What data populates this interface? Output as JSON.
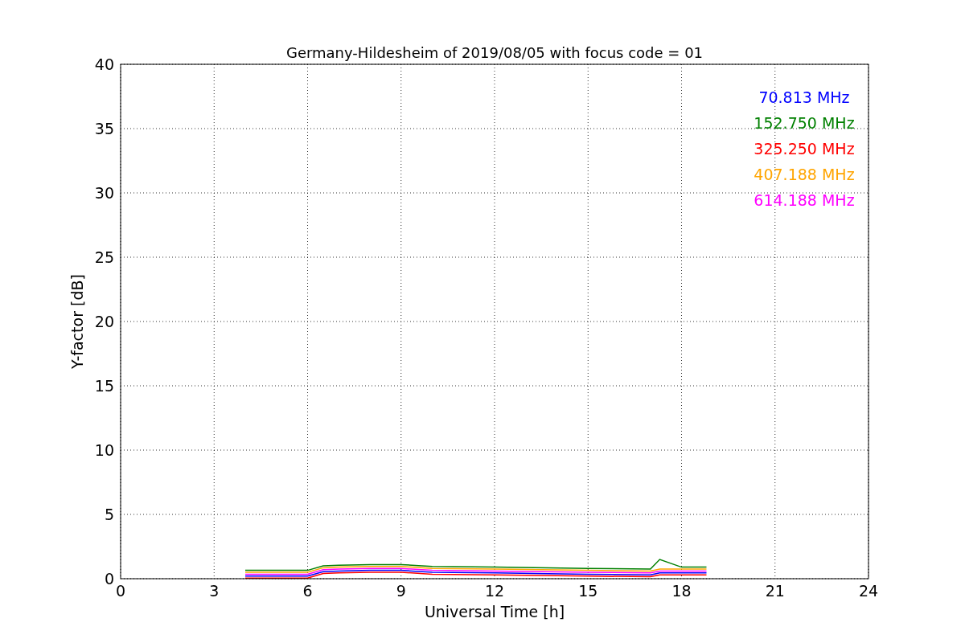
{
  "chart_data": {
    "type": "line",
    "title": "Germany-Hildesheim of 2019/08/05 with focus code = 01",
    "xlabel": "Universal Time [h]",
    "ylabel": "Y-factor [dB]",
    "grid": true,
    "x": [
      4,
      5,
      6,
      6.5,
      7,
      8,
      9,
      10,
      12,
      15,
      17,
      17.3,
      18,
      18.8
    ],
    "series": [
      {
        "name": "70.813 MHz",
        "color": "#0000ff",
        "values": [
          0.2,
          0.2,
          0.2,
          0.55,
          0.6,
          0.65,
          0.65,
          0.5,
          0.45,
          0.35,
          0.3,
          0.45,
          0.45,
          0.45
        ]
      },
      {
        "name": "152.750 MHz",
        "color": "#008000",
        "values": [
          0.65,
          0.65,
          0.65,
          1.0,
          1.05,
          1.1,
          1.1,
          0.95,
          0.9,
          0.8,
          0.75,
          1.5,
          0.9,
          0.9
        ]
      },
      {
        "name": "325.250 MHz",
        "color": "#ff0000",
        "values": [
          0.05,
          0.05,
          0.05,
          0.4,
          0.45,
          0.5,
          0.5,
          0.35,
          0.3,
          0.2,
          0.15,
          0.3,
          0.3,
          0.3
        ]
      },
      {
        "name": "407.188 MHz",
        "color": "#ffa500",
        "values": [
          0.5,
          0.5,
          0.5,
          0.85,
          0.9,
          0.95,
          0.95,
          0.8,
          0.75,
          0.65,
          0.6,
          0.75,
          0.75,
          0.75
        ]
      },
      {
        "name": "614.188 MHz",
        "color": "#ff00ff",
        "values": [
          0.35,
          0.35,
          0.35,
          0.7,
          0.75,
          0.8,
          0.8,
          0.65,
          0.6,
          0.5,
          0.45,
          0.6,
          0.6,
          0.6
        ]
      }
    ],
    "xlim": [
      0,
      24
    ],
    "ylim": [
      0,
      40
    ],
    "xticks": [
      0,
      3,
      6,
      9,
      12,
      15,
      18,
      21,
      24
    ],
    "yticks": [
      0,
      5,
      10,
      15,
      20,
      25,
      30,
      35,
      40
    ]
  }
}
